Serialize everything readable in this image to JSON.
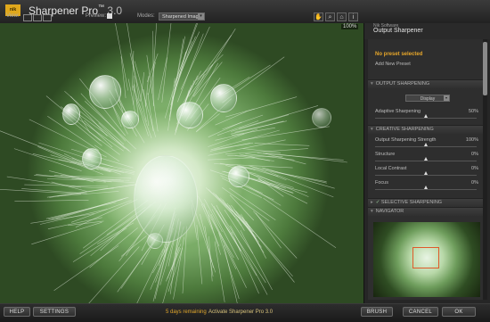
{
  "app": {
    "brand_badge": "nik",
    "title": "Sharpener Pro",
    "trademark": "™",
    "version": "3.0"
  },
  "toolbar": {
    "view_label": "View:",
    "preview_label": "Preview:",
    "preview_checked": true,
    "modes_label": "Modes:",
    "modes_value": "Sharpened Image",
    "zoom_label": "100%",
    "icons": [
      "hand-icon",
      "zoom-icon",
      "home-icon",
      "info-icon"
    ]
  },
  "panel": {
    "brand": "Nik Software",
    "title": "Output Sharpener",
    "preset_none": "No preset selected",
    "preset_add": "Add New Preset",
    "sections": {
      "output": "OUTPUT SHARPENING",
      "creative": "CREATIVE SHARPENING",
      "selective": "SELECTIVE SHARPENING",
      "navigator": "NAVIGATOR"
    },
    "output_type": "Display",
    "adaptive_label": "Adaptive Sharpening",
    "adaptive_value": "50%",
    "sliders": [
      {
        "label": "Output Sharpening Strength",
        "value": "100%",
        "position": 0.5
      },
      {
        "label": "Structure",
        "value": "0%",
        "position": 0.5
      },
      {
        "label": "Local Contrast",
        "value": "0%",
        "position": 0.5
      },
      {
        "label": "Focus",
        "value": "0%",
        "position": 0.5
      }
    ]
  },
  "bottom": {
    "help": "HELP",
    "settings": "SETTINGS",
    "days_remaining": "5 days remaining",
    "activate": "Activate Sharpener Pro 3.0",
    "brush": "BRUSH",
    "cancel": "CANCEL",
    "ok": "OK"
  },
  "colors": {
    "accent_orange": "#e6a62a",
    "panel_bg": "#262626",
    "nav_rect": "#e05a2a"
  }
}
